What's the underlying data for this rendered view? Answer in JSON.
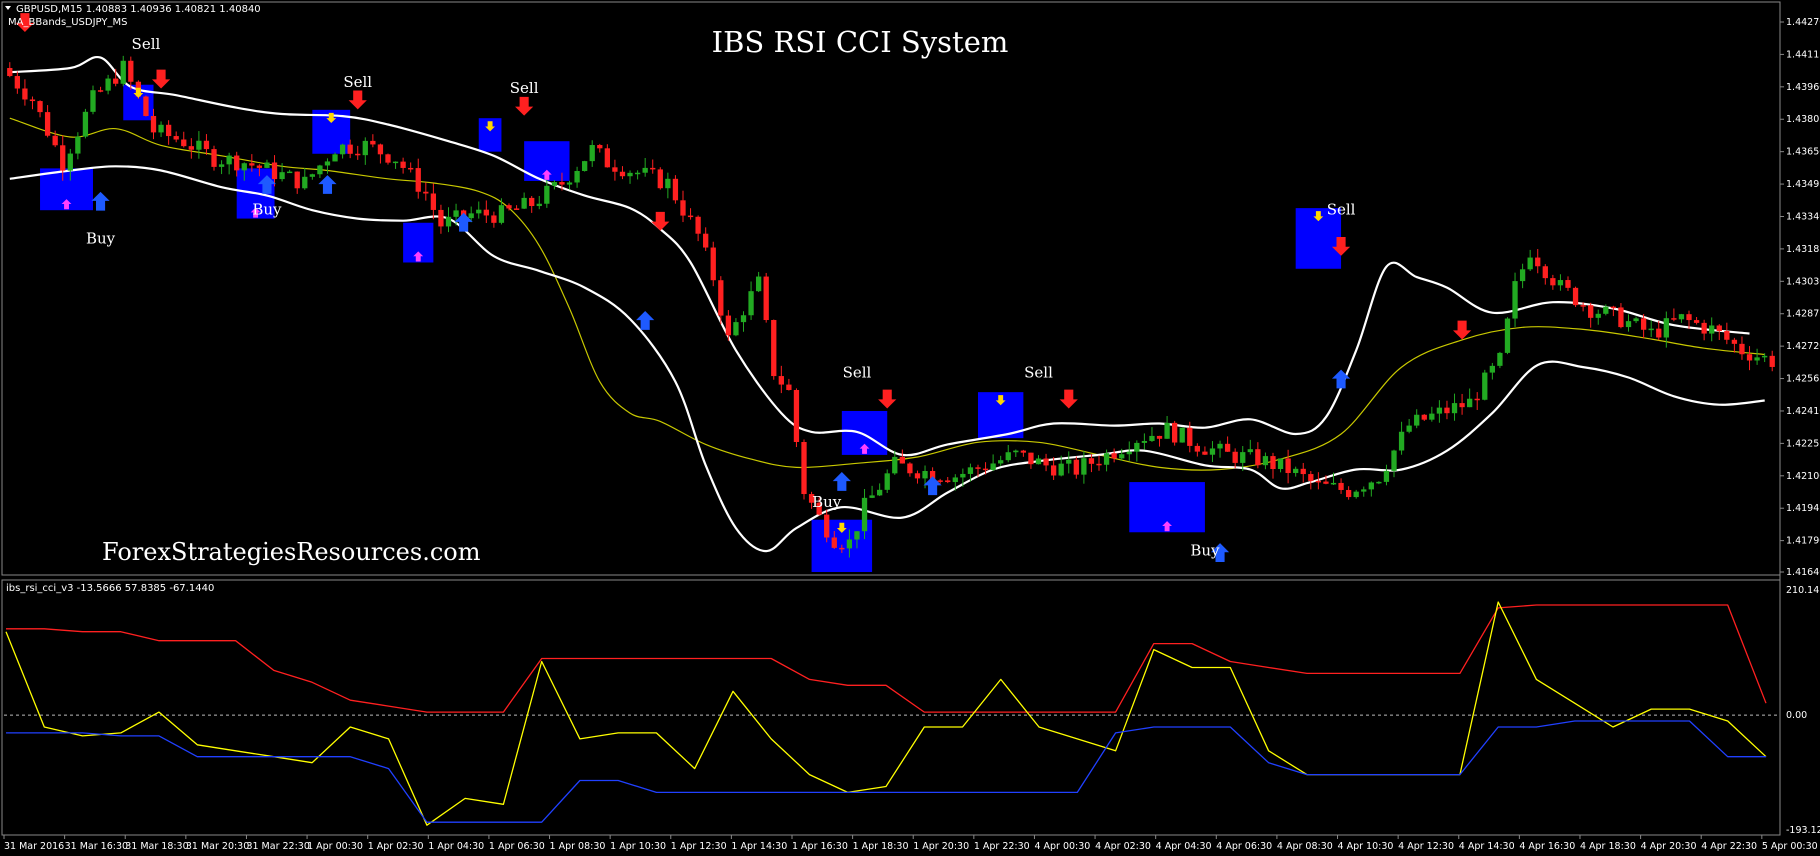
{
  "header": {
    "symbol_line": "GBPUSD,M15  1.40883 1.40936 1.40821 1.40840",
    "indicator_line": "MA_BBands_USDJPY_MS"
  },
  "title": "IBS RSI CCI System",
  "watermark": "ForexStrategiesResources.com",
  "indicator_header": "ibs_rsi_cci_v3 -13.5666 57.8385 -67.1440",
  "colors": {
    "background": "#000000",
    "bull": "#22aa22",
    "bear": "#ff2020",
    "band": "#ffffff",
    "middle_line": "#c8c800",
    "box": "#0000ff",
    "osc_red": "#ff2020",
    "osc_yellow": "#ffff00",
    "osc_blue": "#2040ff",
    "sell_arrow": "#ff2020",
    "buy_arrow": "#1e5aff",
    "small_up": "#ff40ff",
    "small_down": "#ffd700"
  },
  "chart_data": [
    {
      "type": "candlestick",
      "title": "IBS RSI CCI System",
      "xlabel": "",
      "ylabel": "",
      "ylim": [
        1.4164,
        1.4427
      ],
      "y_ticks": [
        "1.44270",
        "1.44115",
        "1.43960",
        "1.43805",
        "1.43650",
        "1.43495",
        "1.43340",
        "1.43185",
        "1.43030",
        "1.42875",
        "1.42720",
        "1.42565",
        "1.42410",
        "1.42255",
        "1.42100",
        "1.41945",
        "1.41790",
        "1.41640"
      ],
      "x_ticks": [
        "31 Mar 2016",
        "31 Mar 16:30",
        "31 Mar 18:30",
        "31 Mar 20:30",
        "31 Mar 22:30",
        "1 Apr 00:30",
        "1 Apr 02:30",
        "1 Apr 04:30",
        "1 Apr 06:30",
        "1 Apr 08:30",
        "1 Apr 10:30",
        "1 Apr 12:30",
        "1 Apr 14:30",
        "1 Apr 16:30",
        "1 Apr 18:30",
        "1 Apr 20:30",
        "1 Apr 22:30",
        "4 Apr 00:30",
        "4 Apr 02:30",
        "4 Apr 04:30",
        "4 Apr 06:30",
        "4 Apr 08:30",
        "4 Apr 10:30",
        "4 Apr 12:30",
        "4 Apr 14:30",
        "4 Apr 16:30",
        "4 Apr 18:30",
        "4 Apr 20:30",
        "4 Apr 22:30",
        "5 Apr 00:30"
      ],
      "middle_line": [
        [
          0,
          1.4381
        ],
        [
          8,
          1.4372
        ],
        [
          14,
          1.4376
        ],
        [
          20,
          1.4368
        ],
        [
          28,
          1.4363
        ],
        [
          36,
          1.4358
        ],
        [
          42,
          1.4356
        ],
        [
          50,
          1.4352
        ],
        [
          56,
          1.435
        ],
        [
          62,
          1.4346
        ],
        [
          66,
          1.4338
        ],
        [
          70,
          1.432
        ],
        [
          74,
          1.429
        ],
        [
          78,
          1.4255
        ],
        [
          82,
          1.424
        ],
        [
          86,
          1.4236
        ],
        [
          92,
          1.4225
        ],
        [
          98,
          1.4218
        ],
        [
          104,
          1.4214
        ],
        [
          112,
          1.4216
        ],
        [
          120,
          1.4219
        ],
        [
          128,
          1.4226
        ],
        [
          136,
          1.4226
        ],
        [
          144,
          1.422
        ],
        [
          152,
          1.4214
        ],
        [
          160,
          1.4213
        ],
        [
          168,
          1.4218
        ],
        [
          176,
          1.423
        ],
        [
          184,
          1.4262
        ],
        [
          192,
          1.4275
        ],
        [
          200,
          1.4281
        ],
        [
          208,
          1.428
        ],
        [
          216,
          1.4276
        ],
        [
          224,
          1.4271
        ],
        [
          232,
          1.4268
        ]
      ],
      "upper_band": [
        [
          0,
          1.4403
        ],
        [
          8,
          1.4405
        ],
        [
          12,
          1.441
        ],
        [
          16,
          1.4396
        ],
        [
          22,
          1.4392
        ],
        [
          30,
          1.4386
        ],
        [
          36,
          1.4383
        ],
        [
          44,
          1.4382
        ],
        [
          50,
          1.4378
        ],
        [
          58,
          1.437
        ],
        [
          64,
          1.4363
        ],
        [
          70,
          1.4352
        ],
        [
          76,
          1.4344
        ],
        [
          82,
          1.4338
        ],
        [
          86,
          1.4328
        ],
        [
          90,
          1.4312
        ],
        [
          96,
          1.427
        ],
        [
          102,
          1.424
        ],
        [
          106,
          1.4231
        ],
        [
          112,
          1.4231
        ],
        [
          118,
          1.422
        ],
        [
          124,
          1.4225
        ],
        [
          132,
          1.423
        ],
        [
          138,
          1.4235
        ],
        [
          146,
          1.4234
        ],
        [
          152,
          1.4235
        ],
        [
          158,
          1.4233
        ],
        [
          164,
          1.4237
        ],
        [
          170,
          1.423
        ],
        [
          174,
          1.4238
        ],
        [
          178,
          1.427
        ],
        [
          182,
          1.431
        ],
        [
          186,
          1.4305
        ],
        [
          190,
          1.43
        ],
        [
          196,
          1.4288
        ],
        [
          204,
          1.4293
        ],
        [
          212,
          1.429
        ],
        [
          220,
          1.4282
        ],
        [
          230,
          1.4278
        ]
      ],
      "lower_band": [
        [
          0,
          1.4352
        ],
        [
          8,
          1.4356
        ],
        [
          14,
          1.4358
        ],
        [
          20,
          1.4356
        ],
        [
          28,
          1.4348
        ],
        [
          34,
          1.4344
        ],
        [
          40,
          1.4337
        ],
        [
          46,
          1.4333
        ],
        [
          52,
          1.4332
        ],
        [
          58,
          1.4333
        ],
        [
          64,
          1.4315
        ],
        [
          70,
          1.4308
        ],
        [
          76,
          1.43
        ],
        [
          82,
          1.4285
        ],
        [
          88,
          1.4255
        ],
        [
          92,
          1.4215
        ],
        [
          96,
          1.4185
        ],
        [
          100,
          1.4174
        ],
        [
          104,
          1.4185
        ],
        [
          110,
          1.4195
        ],
        [
          118,
          1.419
        ],
        [
          124,
          1.4202
        ],
        [
          130,
          1.4213
        ],
        [
          136,
          1.4217
        ],
        [
          144,
          1.422
        ],
        [
          150,
          1.4222
        ],
        [
          158,
          1.4215
        ],
        [
          164,
          1.4213
        ],
        [
          168,
          1.4204
        ],
        [
          172,
          1.4207
        ],
        [
          178,
          1.4213
        ],
        [
          184,
          1.4213
        ],
        [
          190,
          1.4222
        ],
        [
          196,
          1.424
        ],
        [
          202,
          1.4263
        ],
        [
          208,
          1.4262
        ],
        [
          214,
          1.4257
        ],
        [
          220,
          1.4248
        ],
        [
          226,
          1.4244
        ],
        [
          232,
          1.4246
        ]
      ],
      "price_path": [
        [
          0,
          1.4405
        ],
        [
          4,
          1.439
        ],
        [
          8,
          1.436
        ],
        [
          12,
          1.439
        ],
        [
          16,
          1.4405
        ],
        [
          20,
          1.4375
        ],
        [
          24,
          1.437
        ],
        [
          28,
          1.4362
        ],
        [
          32,
          1.436
        ],
        [
          36,
          1.4355
        ],
        [
          40,
          1.435
        ],
        [
          44,
          1.4367
        ],
        [
          48,
          1.4368
        ],
        [
          52,
          1.4362
        ],
        [
          56,
          1.4345
        ],
        [
          58,
          1.433
        ],
        [
          62,
          1.4335
        ],
        [
          66,
          1.4335
        ],
        [
          70,
          1.434
        ],
        [
          74,
          1.435
        ],
        [
          78,
          1.4366
        ],
        [
          80,
          1.436
        ],
        [
          84,
          1.4355
        ],
        [
          88,
          1.435
        ],
        [
          92,
          1.4325
        ],
        [
          94,
          1.4305
        ],
        [
          96,
          1.4275
        ],
        [
          98,
          1.429
        ],
        [
          100,
          1.4302
        ],
        [
          102,
          1.426
        ],
        [
          104,
          1.425
        ],
        [
          106,
          1.4203
        ],
        [
          108,
          1.419
        ],
        [
          110,
          1.418
        ],
        [
          112,
          1.4178
        ],
        [
          114,
          1.4195
        ],
        [
          118,
          1.4215
        ],
        [
          122,
          1.4212
        ],
        [
          126,
          1.421
        ],
        [
          130,
          1.4215
        ],
        [
          134,
          1.422
        ],
        [
          138,
          1.4215
        ],
        [
          142,
          1.4213
        ],
        [
          146,
          1.422
        ],
        [
          150,
          1.4228
        ],
        [
          154,
          1.4232
        ],
        [
          158,
          1.4225
        ],
        [
          162,
          1.422
        ],
        [
          166,
          1.4218
        ],
        [
          170,
          1.4213
        ],
        [
          174,
          1.4205
        ],
        [
          178,
          1.4203
        ],
        [
          182,
          1.421
        ],
        [
          186,
          1.4234
        ],
        [
          190,
          1.424
        ],
        [
          194,
          1.4245
        ],
        [
          198,
          1.4265
        ],
        [
          200,
          1.43
        ],
        [
          202,
          1.4318
        ],
        [
          206,
          1.43
        ],
        [
          210,
          1.429
        ],
        [
          214,
          1.4285
        ],
        [
          218,
          1.4278
        ],
        [
          222,
          1.4285
        ],
        [
          226,
          1.428
        ],
        [
          230,
          1.427
        ],
        [
          234,
          1.4265
        ]
      ],
      "annotations": [
        {
          "text": "Sell",
          "x": 18,
          "y": 1.4414
        },
        {
          "text": "Sell",
          "x": 46,
          "y": 1.4396
        },
        {
          "text": "Sell",
          "x": 68,
          "y": 1.4393
        },
        {
          "text": "Sell",
          "x": 112,
          "y": 1.4257
        },
        {
          "text": "Sell",
          "x": 136,
          "y": 1.4257
        },
        {
          "text": "Sell",
          "x": 176,
          "y": 1.4335
        },
        {
          "text": "Buy",
          "x": 12,
          "y": 1.4321
        },
        {
          "text": "Buy",
          "x": 34,
          "y": 1.4335
        },
        {
          "text": "Buy",
          "x": 108,
          "y": 1.4195
        },
        {
          "text": "Buy",
          "x": 158,
          "y": 1.4172
        }
      ],
      "sell_arrows": [
        [
          2,
          1.4425
        ],
        [
          20,
          1.4398
        ],
        [
          46,
          1.4388
        ],
        [
          68,
          1.4385
        ],
        [
          86,
          1.433
        ],
        [
          116,
          1.4245
        ],
        [
          140,
          1.4245
        ],
        [
          176,
          1.4318
        ],
        [
          192,
          1.4278
        ]
      ],
      "buy_arrows": [
        [
          12,
          1.4343
        ],
        [
          34,
          1.4351
        ],
        [
          42,
          1.4351
        ],
        [
          60,
          1.4333
        ],
        [
          84,
          1.4286
        ],
        [
          110,
          1.4209
        ],
        [
          122,
          1.4207
        ],
        [
          160,
          1.4175
        ],
        [
          176,
          1.4258
        ]
      ],
      "signal_boxes": [
        [
          4,
          1.4357,
          11,
          1.4337
        ],
        [
          15,
          1.4397,
          19,
          1.438
        ],
        [
          30,
          1.4357,
          35,
          1.4333
        ],
        [
          40,
          1.4385,
          45,
          1.4364
        ],
        [
          52,
          1.4331,
          56,
          1.4312
        ],
        [
          62,
          1.4381,
          65,
          1.4365
        ],
        [
          68,
          1.437,
          74,
          1.4351
        ],
        [
          106,
          1.4189,
          114,
          1.4164
        ],
        [
          110,
          1.4241,
          116,
          1.422
        ],
        [
          128,
          1.425,
          134,
          1.4228
        ],
        [
          148,
          1.4207,
          158,
          1.4183
        ],
        [
          170,
          1.4338,
          176,
          1.4309
        ]
      ]
    },
    {
      "type": "line",
      "title": "ibs_rsi_cci_v3",
      "ylim": [
        -193.1273,
        210.1419
      ],
      "y_ticks": [
        "210.1419",
        "0.00",
        "-193.1273"
      ],
      "x": [
        0,
        5,
        10,
        15,
        20,
        25,
        30,
        35,
        40,
        45,
        50,
        55,
        60,
        65,
        70,
        75,
        80,
        85,
        90,
        95,
        100,
        105,
        110,
        115,
        120,
        125,
        130,
        135,
        140,
        145,
        150,
        155,
        160,
        165,
        170,
        175,
        180,
        185,
        190,
        195,
        200,
        205,
        210,
        215,
        220,
        225,
        230
      ],
      "series": [
        {
          "color": "red",
          "values": [
            145,
            145,
            140,
            140,
            125,
            125,
            125,
            75,
            55,
            25,
            15,
            5,
            5,
            5,
            95,
            95,
            95,
            95,
            95,
            95,
            95,
            60,
            50,
            50,
            5,
            5,
            5,
            5,
            5,
            5,
            120,
            120,
            90,
            80,
            70,
            70,
            70,
            70,
            70,
            180,
            185,
            185,
            185,
            185,
            185,
            185,
            20
          ]
        },
        {
          "color": "yellow",
          "values": [
            140,
            -20,
            -35,
            -30,
            5,
            -50,
            -60,
            -70,
            -80,
            -20,
            -40,
            -185,
            -140,
            -150,
            90,
            -40,
            -30,
            -30,
            -90,
            40,
            -40,
            -100,
            -130,
            -120,
            -20,
            -20,
            60,
            -20,
            -40,
            -60,
            110,
            80,
            80,
            -60,
            -100,
            -100,
            -100,
            -100,
            -100,
            190,
            60,
            20,
            -20,
            10,
            10,
            -10,
            -70
          ]
        },
        {
          "color": "blue",
          "values": [
            -30,
            -30,
            -30,
            -35,
            -35,
            -70,
            -70,
            -70,
            -70,
            -70,
            -90,
            -180,
            -180,
            -180,
            -180,
            -110,
            -110,
            -130,
            -130,
            -130,
            -130,
            -130,
            -130,
            -130,
            -130,
            -130,
            -130,
            -130,
            -130,
            -30,
            -20,
            -20,
            -20,
            -80,
            -100,
            -100,
            -100,
            -100,
            -100,
            -20,
            -20,
            -10,
            -10,
            -10,
            -10,
            -70,
            -70
          ]
        }
      ]
    }
  ]
}
